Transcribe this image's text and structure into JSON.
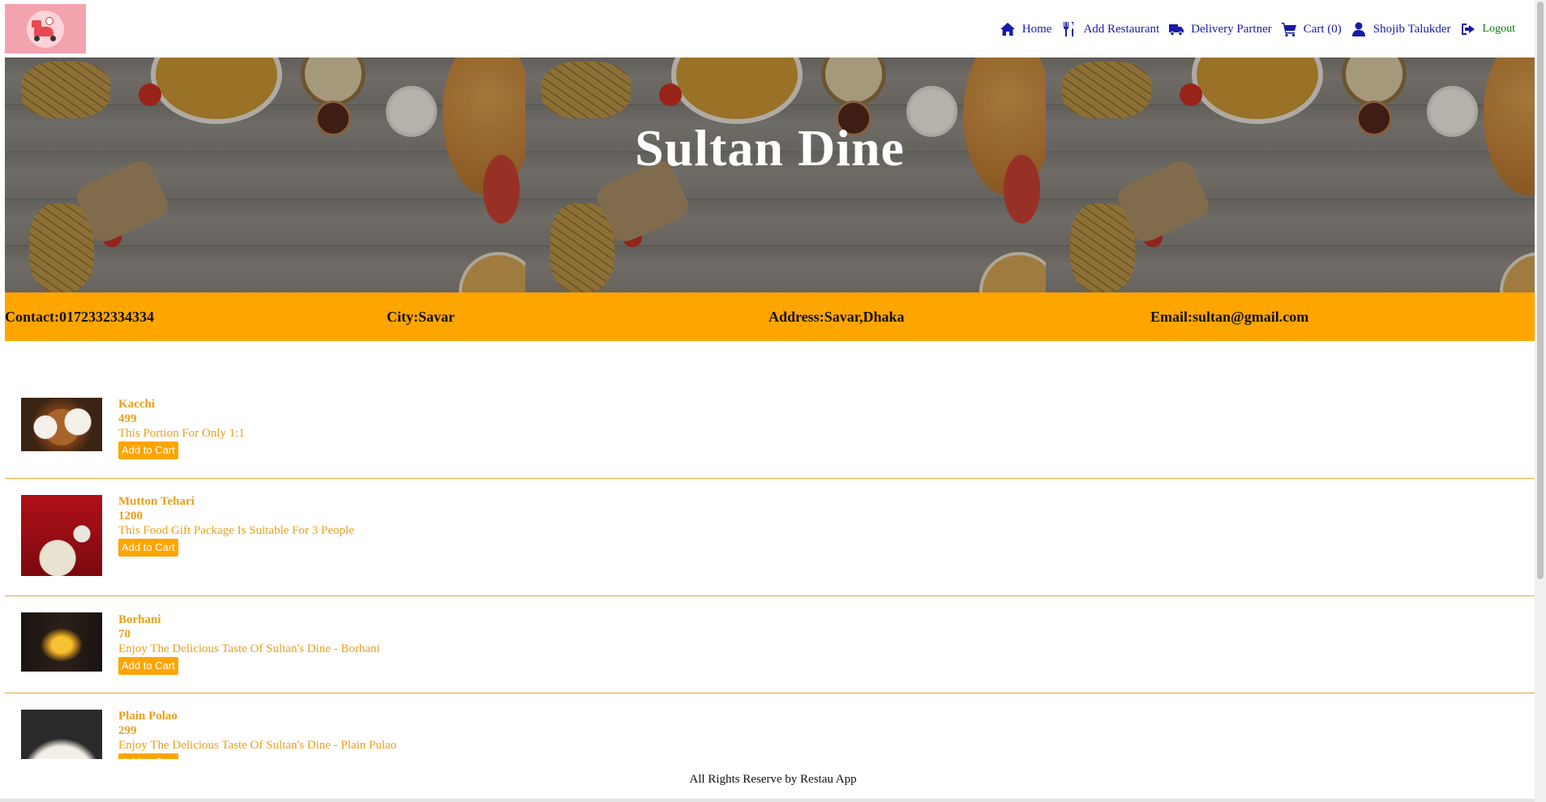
{
  "app": {
    "logo_icon": "delivery-scooter-logo"
  },
  "nav": {
    "items": [
      {
        "label": "Home",
        "icon": "home-icon"
      },
      {
        "label": "Add Restaurant",
        "icon": "utensils-icon"
      },
      {
        "label": "Delivery Partner",
        "icon": "truck-icon"
      },
      {
        "label": "Cart (0)",
        "icon": "cart-icon"
      },
      {
        "label": "Shojib Talukder",
        "icon": "user-icon"
      },
      {
        "label": "Logout",
        "icon": "logout-icon"
      }
    ],
    "link_color": "#1a1aa8",
    "logout_color": "#0a7a0a"
  },
  "banner": {
    "title": "Sultan Dine"
  },
  "info": {
    "contact": "Contact:0172332334334",
    "city": "City:Savar",
    "address": "Address:Savar,Dhaka",
    "email": "Email:sultan@gmail.com",
    "bar_color": "#ffa500"
  },
  "menu": {
    "add_label": "Add to Cart",
    "items": [
      {
        "name": "Kacchi",
        "price": "499",
        "description": "This Portion For Only 1:1"
      },
      {
        "name": "Mutton Tehari",
        "price": "1200",
        "description": "This Food Gift Package Is Suitable For 3 People"
      },
      {
        "name": "Borhani",
        "price": "70",
        "description": "Enjoy The Delicious Taste Of Sultan's Dine - Borhani"
      },
      {
        "name": "Plain Polao",
        "price": "299",
        "description": "Enjoy The Delicious Taste Of Sultan's Dine - Plain Pulao"
      }
    ],
    "text_color": "#e8a01a"
  },
  "footer": {
    "text": "All Rights Reserve by Restau App"
  }
}
